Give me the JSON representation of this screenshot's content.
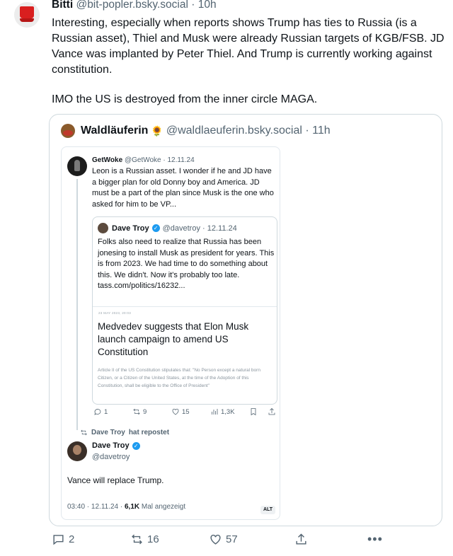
{
  "outer_post": {
    "author_name": "Bitti",
    "author_handle": "@bit-popler.bsky.social",
    "separator": "·",
    "time": "10h",
    "paragraph_1": "Interesting, especially when reports shows Trump has ties to Russia (is a Russian asset), Thiel and Musk were already Russian targets of KGB/FSB. JD Vance was implanted by Peter Thiel. And Trump is currently working against constitution.",
    "paragraph_2": "IMO the US is destroyed from the inner circle MAGA.",
    "actions": {
      "reply_count": "2",
      "repost_count": "16",
      "like_count": "57"
    }
  },
  "quoted_post": {
    "author_name": "Waldläuferin",
    "emoji": "🌻",
    "author_handle": "@waldlaeuferin.bsky.social",
    "separator": "·",
    "time": "11h"
  },
  "screenshot": {
    "getwoke": {
      "name": "GetWoke",
      "meta": "@GetWoke · 12.11.24",
      "text": "Leon is a Russian asset. I wonder if he and JD have a bigger plan for old Donny boy and America. JD must be a part of the plan since Musk is the one who asked for him to be VP..."
    },
    "davetroy_quote": {
      "name": "Dave Troy",
      "meta": "@davetroy · 12.11.24",
      "text": "Folks also need to realize that Russia has been jonesing to install Musk as president for years. This is from 2023. We had time to do something about this. We didn't. Now it's probably too late.",
      "link": "tass.com/politics/16232...",
      "article_date": "23 MAY 2023, 20:03",
      "article_title": "Medvedev suggests that Elon Musk launch campaign to amend US Constitution",
      "article_desc": "Article II of the US Constitution stipulates that: \"No Person except a natural born Citizen, or a Citizen of the United States, at the time of the Adoption of this Constitution, shall be eligible to the Office of President\""
    },
    "getwoke_actions": {
      "replies": "1",
      "reposts": "9",
      "likes": "15",
      "views": "1,3K"
    },
    "repost_label": {
      "name": "Dave Troy",
      "suffix": "hat repostet"
    },
    "davetroy_post": {
      "name": "Dave Troy",
      "handle": "@davetroy",
      "text": "Vance will replace Trump.",
      "meta_time": "03:40 · 12.11.24 ·",
      "views": "6,1K",
      "views_label": "Mal angezeigt",
      "alt": "ALT"
    }
  },
  "colors": {
    "text": "#0f1419",
    "secondary": "#536471",
    "border": "#cfd9de",
    "verified": "#1d9bf0"
  }
}
